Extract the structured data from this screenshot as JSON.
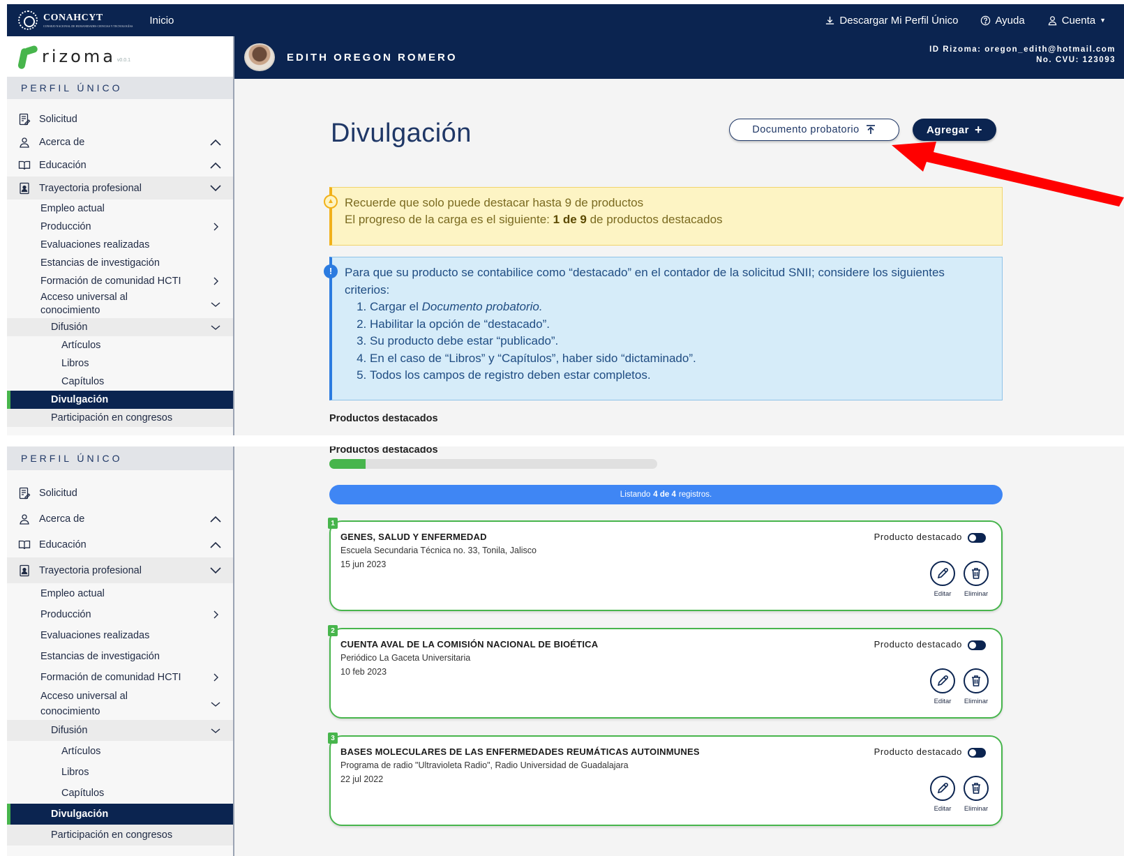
{
  "topnav": {
    "brand": "CONAHCYT",
    "brand_sub": "CONSEJO NACIONAL DE HUMANIDADES CIENCIAS Y TECNOLOGÍAS",
    "home": "Inicio",
    "download": "Descargar Mi Perfil Único",
    "help": "Ayuda",
    "account": "Cuenta"
  },
  "sidebar": {
    "logo_word": "rizoma",
    "logo_version": "v0.0.1",
    "section": "PERFIL ÚNICO",
    "items": {
      "solicitud": "Solicitud",
      "acerca": "Acerca de",
      "educacion": "Educación",
      "trayectoria": "Trayectoria profesional",
      "empleo": "Empleo actual",
      "produccion": "Producción",
      "evaluaciones": "Evaluaciones realizadas",
      "estancias": "Estancias de investigación",
      "formacion": "Formación de comunidad HCTI",
      "acceso_1": "Acceso universal al",
      "acceso_2": "conocimiento",
      "difusion": "Difusión",
      "articulos": "Artículos",
      "libros": "Libros",
      "capitulos": "Capítulos",
      "divulgacion": "Divulgación",
      "participacion": "Participación en congresos"
    }
  },
  "user": {
    "name": "EDITH OREGON ROMERO",
    "id_line": "ID Rizoma: oregon_edith@hotmail.com",
    "cvu_line": "No. CVU: 123093"
  },
  "main": {
    "title": "Divulgación",
    "doc_button": "Documento probatorio",
    "add_button": "Agregar",
    "alert_warn_1": "Recuerde que solo puede destacar hasta 9 de productos",
    "alert_warn_2_pre": "El progreso de la carga es el siguiente:",
    "alert_warn_2_bold": "1 de 9",
    "alert_warn_2_post": "de productos destacados",
    "alert_info_intro": "Para que su producto se contabilice como “destacado” en el contador de la solicitud SNII; considere los siguientes criterios:",
    "criteria_1_pre": "Cargar el",
    "criteria_1_em": "Documento probatorio.",
    "criteria_2": "Habilitar la opción de “destacado”.",
    "criteria_3": "Su producto debe estar “publicado”.",
    "criteria_4": "En el caso de “Libros” y “Capítulos”, haber sido “dictaminado”.",
    "criteria_5": "Todos los campos de registro deben estar completos.",
    "featured_title": "Productos destacados",
    "featured_progress": 0.11,
    "list_pre": "Listando",
    "list_bold": "4 de 4",
    "list_post": "registros.",
    "featured_label": "Producto destacado",
    "edit_label": "Editar",
    "delete_label": "Eliminar"
  },
  "records": [
    {
      "num": "1",
      "title": "GENES, SALUD Y ENFERMEDAD",
      "org": "Escuela Secundaria Técnica no. 33, Tonila, Jalisco",
      "date": "15 jun 2023"
    },
    {
      "num": "2",
      "title": "CUENTA AVAL DE LA COMISIÓN NACIONAL DE BIOÉTICA",
      "org": "Periódico La Gaceta Universitaria",
      "date": "10 feb 2023"
    },
    {
      "num": "3",
      "title": "BASES MOLECULARES DE LAS ENFERMEDADES REUMÁTICAS AUTOINMUNES",
      "org": "Programa de radio \"Ultravioleta Radio\", Radio Universidad de Guadalajara",
      "date": "22 jul 2022"
    }
  ],
  "colors": {
    "navy": "#0b2450",
    "green": "#47b54c",
    "blue": "#3f86f4",
    "annotation_arrow": "#ff0000"
  }
}
